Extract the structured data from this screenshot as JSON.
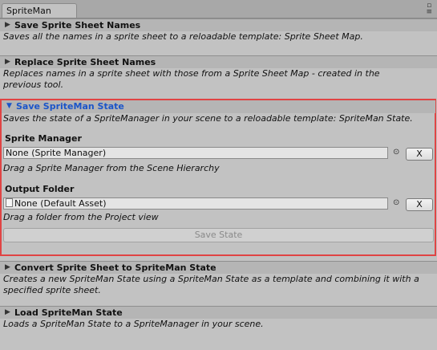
{
  "window": {
    "tab_title": "SpriteMan"
  },
  "sections": [
    {
      "title": "Save Sprite Sheet Names",
      "desc": [
        "Saves all the names in a sprite sheet to a reloadable template: Sprite Sheet Map."
      ]
    },
    {
      "title": "Replace Sprite Sheet Names",
      "desc": [
        "Replaces names in a sprite sheet with those from a Sprite Sheet Map - created in the",
        "previous tool."
      ]
    },
    {
      "title": "Save SpriteMan State",
      "desc": [
        "Saves the state of a SpriteManager in your scene to a reloadable template: SpriteMan State."
      ]
    },
    {
      "title": "Convert Sprite Sheet to SpriteMan State",
      "desc": [
        "Creates a new SpriteMan State using a SpriteMan State as a template and combining it with a",
        "specified sprite sheet."
      ]
    },
    {
      "title": "Load SpriteMan State",
      "desc": [
        "Loads a SpriteMan State to a SpriteManager in your scene."
      ]
    }
  ],
  "sprite_manager": {
    "label": "Sprite Manager",
    "value": "None (Sprite Manager)",
    "hint": "Drag a Sprite Manager from the Scene Hierarchy",
    "clear_label": "X"
  },
  "output_folder": {
    "label": "Output Folder",
    "value": "None (Default Asset)",
    "hint": "Drag a folder from the Project view",
    "clear_label": "X"
  },
  "save_state_label": "Save State",
  "icons": {
    "collapsed": "triangle-right-icon",
    "expanded": "triangle-down-icon",
    "picker": "object-picker-icon"
  }
}
